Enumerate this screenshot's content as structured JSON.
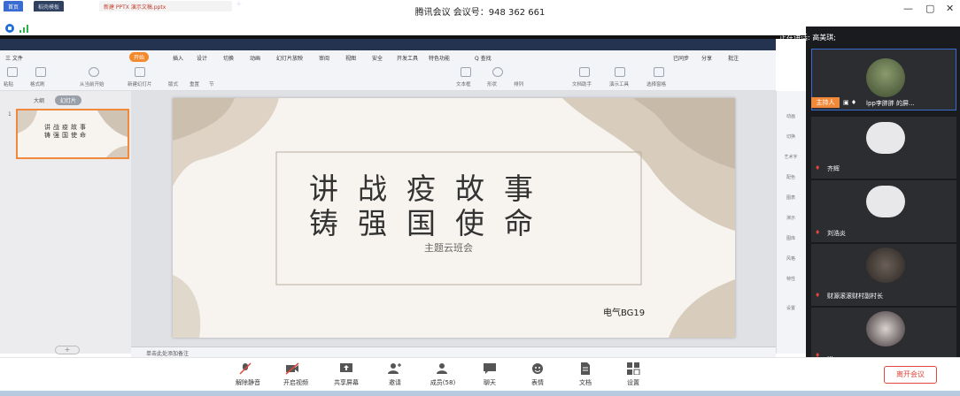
{
  "window": {
    "title": "腾讯会议 会议号：948 362 661",
    "controls": [
      "—",
      "▢",
      "✕"
    ]
  },
  "wps": {
    "tabs": {
      "home": "首页",
      "template": "稻壳模板",
      "doc": "新建 PPTX 演示文稿.pptx"
    },
    "menus": [
      "三 文件",
      "开始",
      "插入",
      "设计",
      "切换",
      "动画",
      "幻灯片放映",
      "审阅",
      "视图",
      "安全",
      "开发工具",
      "特色功能",
      "Q 查找"
    ],
    "start": "开始",
    "ribbon_right": [
      "已同步",
      "分享",
      "批注"
    ],
    "ribbon_labels": [
      "粘贴",
      "格式刷",
      "从当前开始",
      "新建幻灯片",
      "版式",
      "重置",
      "节",
      "文本框",
      "形状",
      "排列",
      "文档助手",
      "演示工具",
      "选择窗格"
    ]
  },
  "left_panel": {
    "tab_outline": "大纲",
    "tab_slides": "幻灯片",
    "thumb_number": "1",
    "thumb_line1": "讲战疫故事",
    "thumb_line2": "铸强国使命",
    "add": "+"
  },
  "slide": {
    "line1": "讲战疫故事",
    "line2": "铸强国使命",
    "subtitle": "主题云班会",
    "author": "电气BG19"
  },
  "notes": "单击此处添加备注",
  "right_tools": [
    "动画",
    "切换",
    "艺术字",
    "配色",
    "图表",
    "演示",
    "图库",
    "风格",
    "特性",
    "设置"
  ],
  "meeting": {
    "speaking": "正在讲话: 高美琪;",
    "host_tag": "主持人",
    "participants": [
      {
        "name": "lpp李胖胖 的屏..."
      },
      {
        "name": "齐辉"
      },
      {
        "name": "刘浩炎"
      },
      {
        "name": "财源滚滚财村副村长"
      },
      {
        "name": "..."
      }
    ]
  },
  "toolbar": {
    "mute": "解除静音",
    "video": "开启视频",
    "share": "共享屏幕",
    "invite": "邀请",
    "members": "成员(58)",
    "chat": "聊天",
    "reactions": "表情",
    "docs": "文档",
    "settings": "设置",
    "leave": "离开会议"
  },
  "colors": {
    "accent_orange": "#f08a3a",
    "leave_red": "#e0463b",
    "wps_blue": "#3a6bd1"
  }
}
